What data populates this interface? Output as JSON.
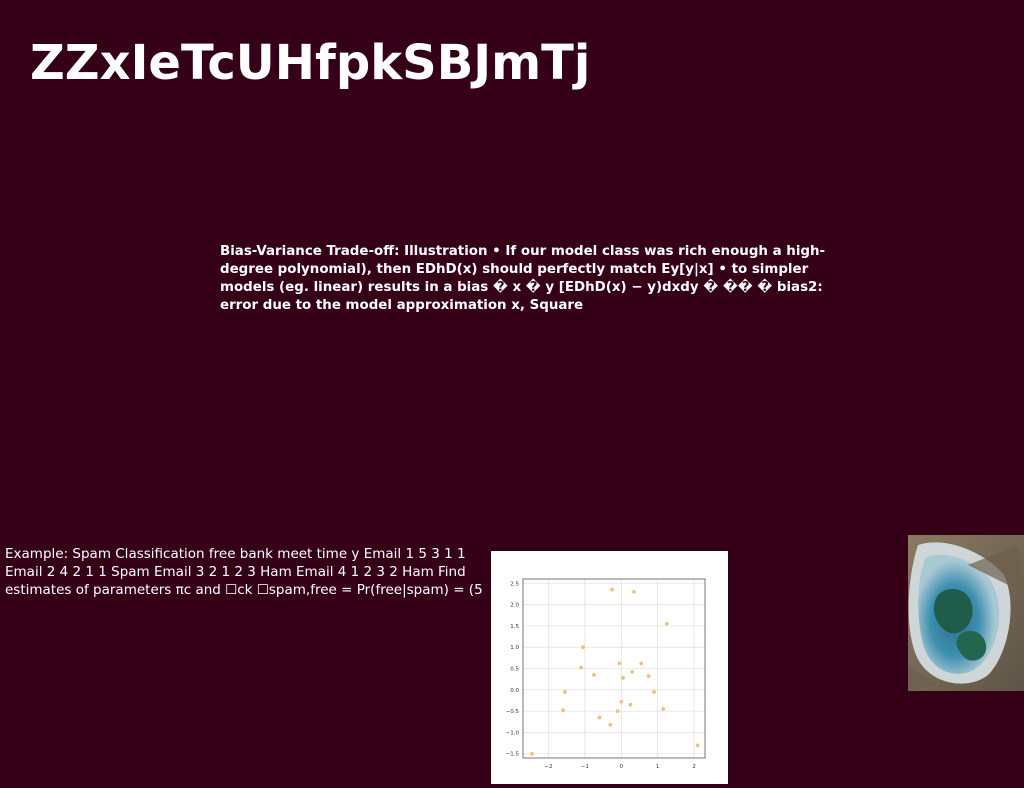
{
  "slide": {
    "title": "ZZxIeTcUHfpkSBJmTj",
    "bias_text": "Bias-Variance Trade-off: Illustration • If our model class was rich enough a high-degree polynomial), then EDhD(x) should perfectly match Ey[y|x] • to simpler models (eg. linear) results in a bias � x � y [EDhD(x) − y)dxdy � �� � bias2: error due to the model approximation x, Square",
    "spam_text": "Example: Spam Classification free bank meet time y Email 1 5 3 1 1\nEmail 2 4 2 1 1 Spam Email 3 2 1 2 3 Ham Email 4 1 2 3 2 Ham Find\nestimates of parameters πc and ☐ck ☐spam,free = Pr(free|spam) = (5"
  },
  "colors": {
    "background": "#350017",
    "point": "#f0c46a",
    "grid": "#d8d8d8"
  },
  "chart_data": {
    "type": "scatter",
    "title": "",
    "xlabel": "",
    "ylabel": "",
    "xlim": [
      -2.7,
      2.3
    ],
    "ylim": [
      -1.6,
      2.6
    ],
    "grid": true,
    "xticks": [
      -2,
      -1,
      0,
      1,
      2
    ],
    "yticks": [
      -1.5,
      -1.0,
      -0.5,
      0.0,
      0.5,
      1.0,
      1.5,
      2.0,
      2.5
    ],
    "xtick_labels": [
      "−2",
      "−1",
      "0",
      "1",
      "2"
    ],
    "ytick_labels": [
      "−1.5",
      "−1.0",
      "−0.5",
      "0.0",
      "0.5",
      "1.0",
      "1.5",
      "2.0",
      "2.5"
    ],
    "series": [
      {
        "x": [
          -2.45,
          -1.6,
          -1.55,
          -1.1,
          -1.05,
          -0.75,
          -0.6,
          -0.3,
          -0.25,
          -0.1,
          -0.05,
          0.0,
          0.05,
          0.25,
          0.3,
          0.35,
          0.55,
          0.75,
          0.9,
          1.15,
          1.25,
          2.1
        ],
        "y": [
          -1.5,
          -0.48,
          -0.05,
          0.52,
          1.0,
          0.35,
          -0.65,
          -0.82,
          2.35,
          -0.5,
          0.62,
          -0.28,
          0.28,
          -0.35,
          0.42,
          2.3,
          0.62,
          0.32,
          -0.05,
          -0.45,
          1.55,
          -1.3
        ]
      }
    ]
  }
}
